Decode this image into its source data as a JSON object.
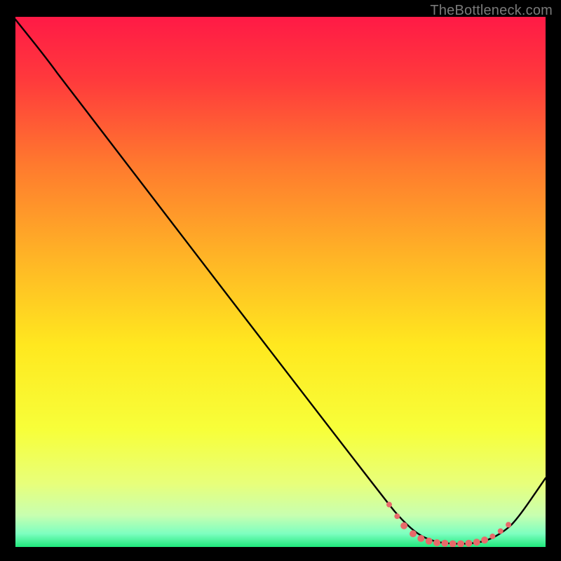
{
  "attribution": "TheBottleneck.com",
  "chart_data": {
    "type": "line",
    "title": "",
    "xlabel": "",
    "ylabel": "",
    "xlim": [
      0,
      100
    ],
    "ylim": [
      0,
      100
    ],
    "gradient_stops": [
      {
        "offset": 0.0,
        "color": "#ff1a46"
      },
      {
        "offset": 0.12,
        "color": "#ff3a3c"
      },
      {
        "offset": 0.28,
        "color": "#ff7a2e"
      },
      {
        "offset": 0.45,
        "color": "#ffb326"
      },
      {
        "offset": 0.62,
        "color": "#ffe81f"
      },
      {
        "offset": 0.78,
        "color": "#f7ff3a"
      },
      {
        "offset": 0.88,
        "color": "#e8ff7a"
      },
      {
        "offset": 0.94,
        "color": "#c8ffb0"
      },
      {
        "offset": 0.975,
        "color": "#7dffc0"
      },
      {
        "offset": 1.0,
        "color": "#20e87c"
      }
    ],
    "series": [
      {
        "name": "bottleneck-curve",
        "color": "#000000",
        "points": [
          {
            "x": 0.0,
            "y": 99.5
          },
          {
            "x": 6.0,
            "y": 92.0
          },
          {
            "x": 10.0,
            "y": 86.5
          },
          {
            "x": 70.0,
            "y": 8.5
          },
          {
            "x": 73.0,
            "y": 5.0
          },
          {
            "x": 76.0,
            "y": 2.3
          },
          {
            "x": 79.0,
            "y": 1.0
          },
          {
            "x": 82.0,
            "y": 0.6
          },
          {
            "x": 86.0,
            "y": 0.6
          },
          {
            "x": 89.0,
            "y": 1.2
          },
          {
            "x": 92.0,
            "y": 2.8
          },
          {
            "x": 94.5,
            "y": 5.0
          },
          {
            "x": 100.0,
            "y": 13.0
          }
        ]
      }
    ],
    "markers": {
      "name": "bottleneck-markers",
      "color": "#e86a6a",
      "radius_small": 4,
      "radius_inner": 2.2,
      "points": [
        {
          "x": 70.5,
          "y": 8.0,
          "r": 4
        },
        {
          "x": 72.0,
          "y": 5.8,
          "r": 4
        },
        {
          "x": 73.3,
          "y": 4.0,
          "r": 5
        },
        {
          "x": 75.0,
          "y": 2.5,
          "r": 5
        },
        {
          "x": 76.5,
          "y": 1.6,
          "r": 5
        },
        {
          "x": 78.0,
          "y": 1.1,
          "r": 5
        },
        {
          "x": 79.5,
          "y": 0.8,
          "r": 5
        },
        {
          "x": 81.0,
          "y": 0.7,
          "r": 5
        },
        {
          "x": 82.5,
          "y": 0.6,
          "r": 5
        },
        {
          "x": 84.0,
          "y": 0.6,
          "r": 5
        },
        {
          "x": 85.5,
          "y": 0.7,
          "r": 5
        },
        {
          "x": 87.0,
          "y": 0.9,
          "r": 5
        },
        {
          "x": 88.5,
          "y": 1.3,
          "r": 5
        },
        {
          "x": 90.0,
          "y": 2.0,
          "r": 4
        },
        {
          "x": 91.5,
          "y": 3.0,
          "r": 4
        },
        {
          "x": 93.0,
          "y": 4.2,
          "r": 4
        }
      ]
    }
  }
}
